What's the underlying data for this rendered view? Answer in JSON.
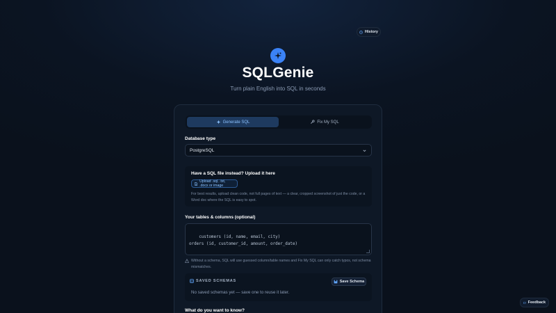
{
  "header": {
    "history_label": "History",
    "app_title": "SQLGenie",
    "app_subtitle": "Turn plain English into SQL in seconds"
  },
  "tabs": [
    {
      "label": "Generate SQL",
      "active": true,
      "icon": "sparkle-icon"
    },
    {
      "label": "Fix My SQL",
      "active": false,
      "icon": "wrench-icon"
    }
  ],
  "database": {
    "label": "Database type",
    "selected": "PostgreSQL"
  },
  "upload": {
    "title": "Have a SQL file instead? Upload it here",
    "button_label": "Upload .sql, .txt, .docx or image",
    "help_text": "For best results, upload clean code, not full pages of text — a clear, cropped screenshot of just the code, or a Word doc where the SQL is easy to spot."
  },
  "schema": {
    "label": "Your tables & columns (optional)",
    "value": "customers (id, name, email, city)\norders (id, customer_id, amount, order_date)",
    "note": "Without a schema, SQL will use guessed column/table names and Fix My SQL can only catch typos, not schema mismatches."
  },
  "saved_schemas": {
    "title": "SAVED SCHEMAS",
    "save_button": "Save Schema",
    "empty_text": "No saved schemas yet — save one to reuse it later."
  },
  "question": {
    "label": "What do you want to know?"
  },
  "feedback_label": "Feedback",
  "colors": {
    "accent": "#3b82f6",
    "background": "#0b1422",
    "card": "#0e1826"
  }
}
